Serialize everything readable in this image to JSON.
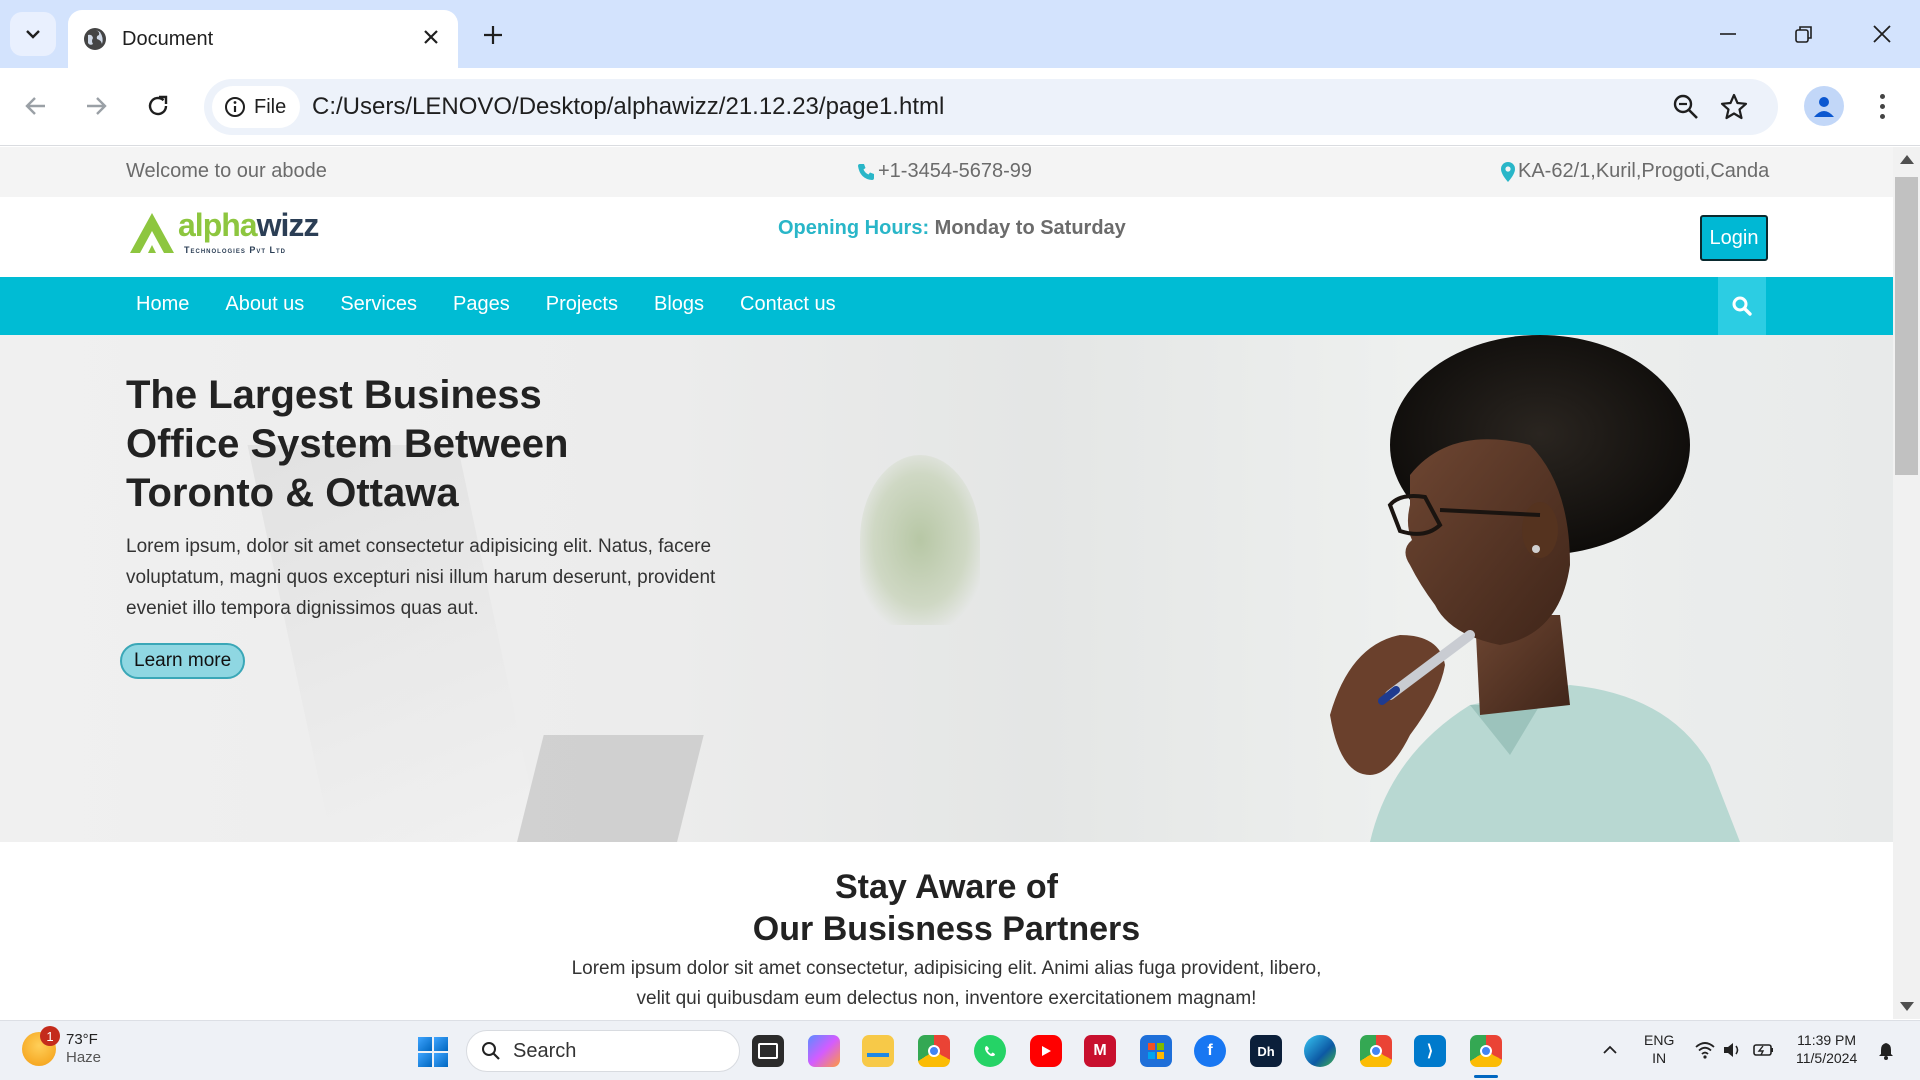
{
  "browser": {
    "tab_title": "Document",
    "file_chip": "File",
    "url": "C:/Users/LENOVO/Desktop/alphawizz/21.12.23/page1.html"
  },
  "site": {
    "topbar": {
      "welcome": "Welcome to our abode",
      "phone": "+1-3454-5678-99",
      "address": "KA-62/1,Kuril,Progoti,Canda"
    },
    "logo": {
      "word_a": "alpha",
      "word_b": "wizz",
      "sub": "Technologies Pvt Ltd"
    },
    "hours_label": "Opening Hours:",
    "hours_value": "Monday to Saturday",
    "login": "Login",
    "nav": [
      "Home",
      "About us",
      "Services",
      "Pages",
      "Projects",
      "Blogs",
      "Contact us"
    ],
    "hero": {
      "title_line1": "The Largest Business",
      "title_line2": "Office System Between",
      "title_line3": "Toronto & Ottawa",
      "text": "Lorem ipsum, dolor sit amet consectetur adipisicing elit. Natus, facere voluptatum, magni quos excepturi nisi illum harum deserunt, provident eveniet illo tempora dignissimos quas aut.",
      "button": "Learn more"
    },
    "partners": {
      "title_line1": "Stay Aware of",
      "title_line2": "Our Busisness Partners",
      "text": "Lorem ipsum dolor sit amet consectetur, adipisicing elit. Animi alias fuga provident, libero, velit qui quibusdam eum delectus non, inventore exercitationem magnam!"
    }
  },
  "taskbar": {
    "weather_temp": "73°F",
    "weather_desc": "Haze",
    "weather_badge": "1",
    "search": "Search",
    "lang_top": "ENG",
    "lang_bottom": "IN",
    "time": "11:39 PM",
    "date": "11/5/2024"
  },
  "colors": {
    "accent": "#00bcd4",
    "logo_green": "#8dc63f",
    "logo_navy": "#2b3e55"
  }
}
